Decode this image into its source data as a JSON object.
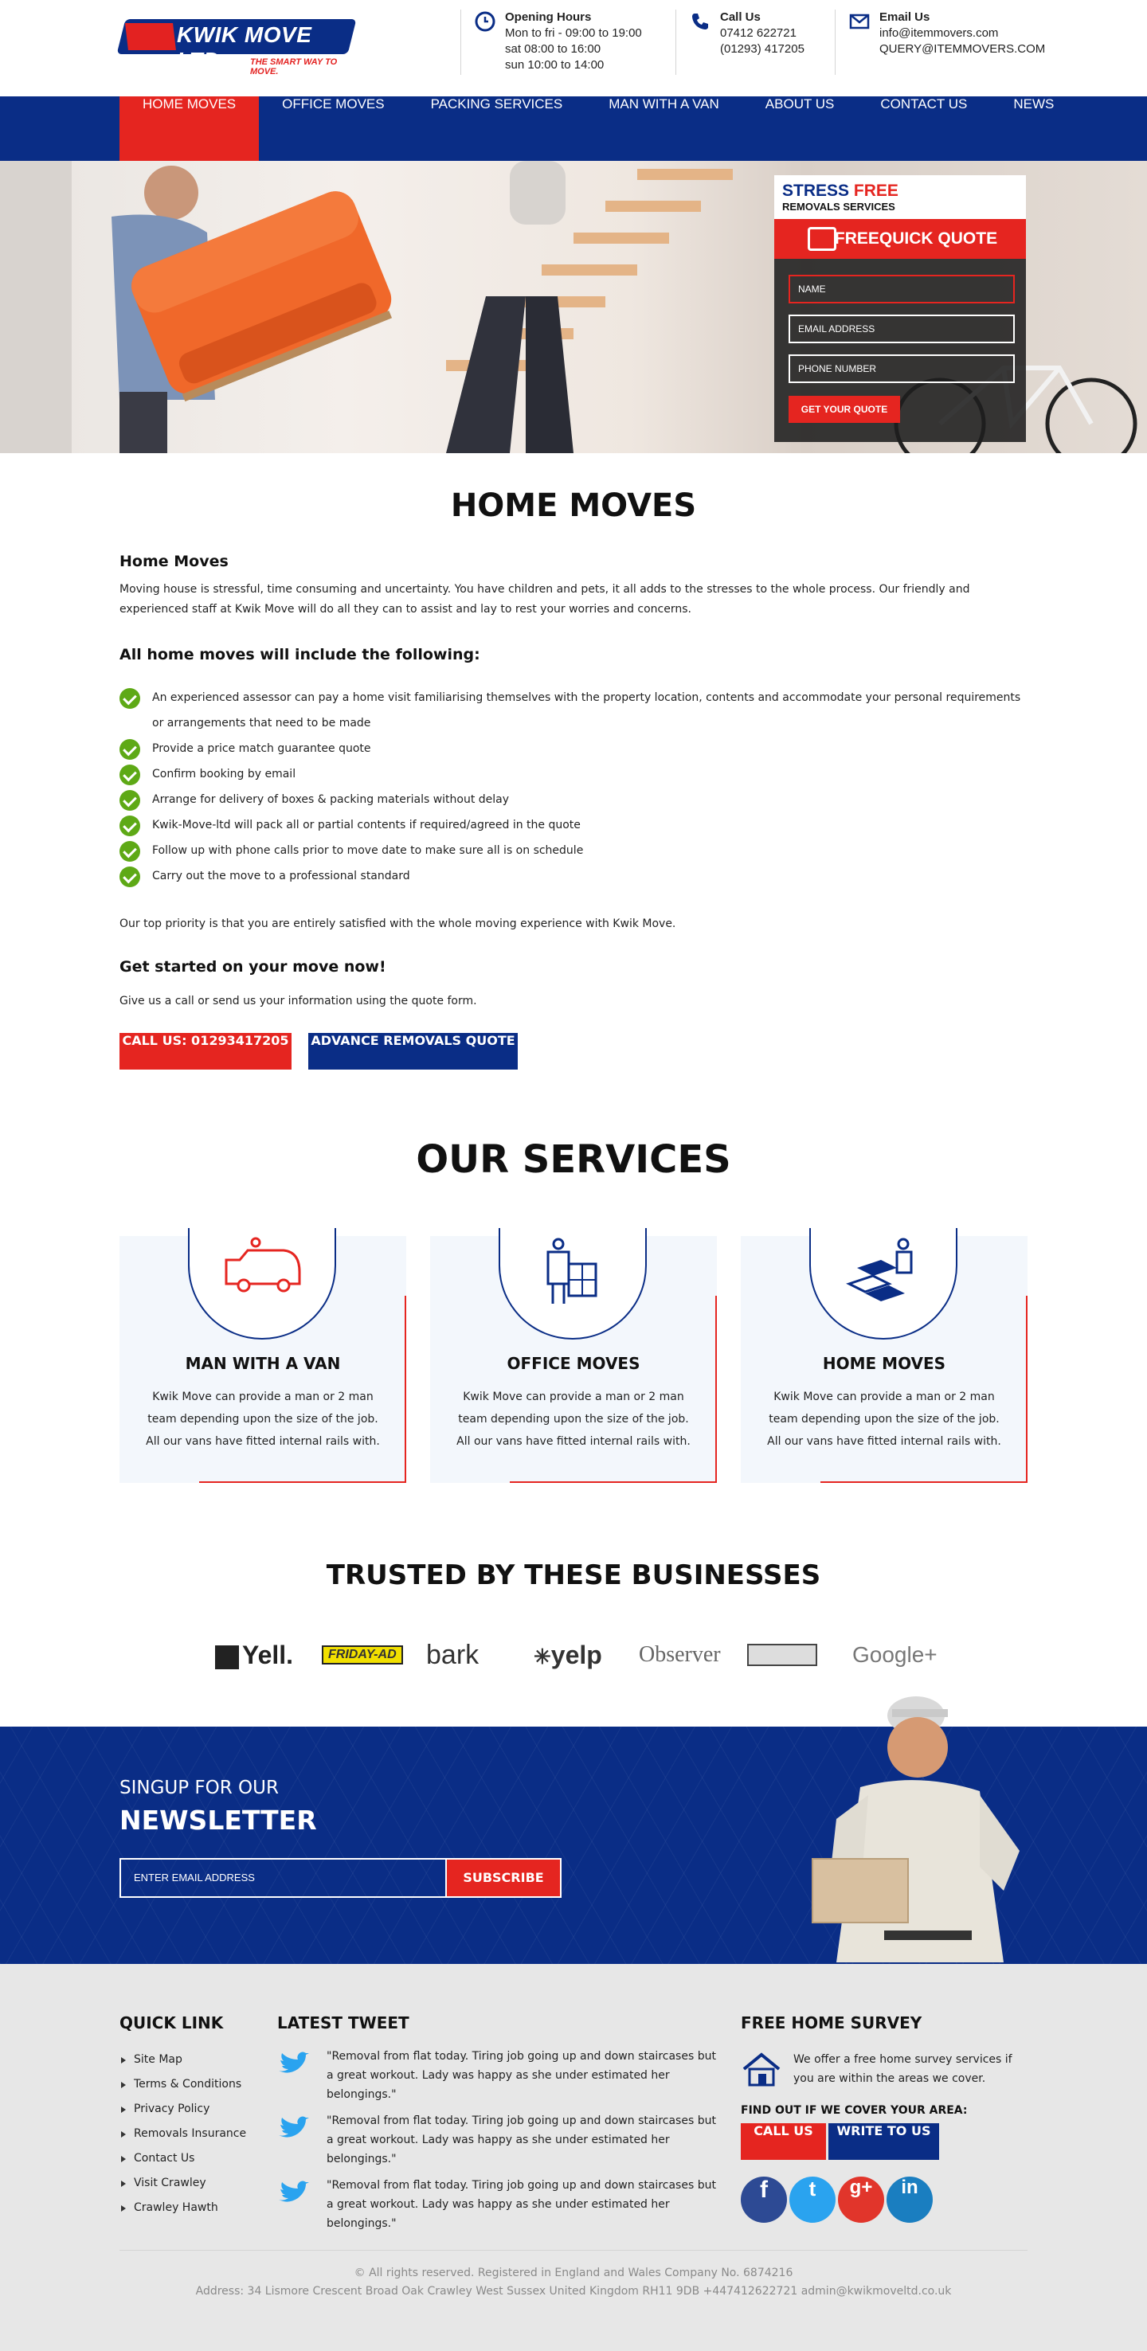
{
  "header": {
    "logo_text": "KWIK MOVE LTD",
    "logo_tagline": "THE SMART WAY TO MOVE.",
    "hours": {
      "title": "Opening Hours",
      "line1": "Mon to fri - 09:00  to 19:00",
      "line2": "sat 08:00  to 16:00",
      "line3": "sun 10:00 to 14:00"
    },
    "call": {
      "title": "Call Us",
      "line1": "07412 622721",
      "line2": "(01293) 417205"
    },
    "email": {
      "title": "Email Us",
      "line1": "info@itemmovers.com",
      "line2": "QUERY@ITEMMOVERS.COM"
    }
  },
  "nav": [
    "HOME MOVES",
    "OFFICE MOVES",
    "PACKING SERVICES",
    "MAN WITH A VAN",
    "ABOUT US",
    "CONTACT US",
    "NEWS"
  ],
  "quote": {
    "stress": "STRESS",
    "free": "FREE",
    "sub": "REMOVALS SERVICES",
    "head": "FREEQUICK QUOTE",
    "name_ph": "NAME",
    "email_ph": "EMAIL ADDRESS",
    "phone_ph": "PHONE NUMBER",
    "button": "GET YOUR QUOTE"
  },
  "home": {
    "title": "HOME MOVES",
    "subtitle": "Home Moves",
    "intro": "Moving house is stressful, time consuming and uncertainty. You have children and pets, it all adds to the stresses to the whole process. Our friendly and experienced staff at Kwik Move will do all they can to assist and lay to rest your worries and concerns.",
    "list_title": "All home moves will include the following:",
    "items": [
      "An experienced assessor can pay a home visit familiarising themselves with the property location, contents and accommodate your personal requirements or arrangements that need to be made",
      "Provide a price match guarantee quote",
      "Confirm booking by email",
      "Arrange for delivery of boxes & packing materials without delay",
      "Kwik-Move-ltd will pack all or partial contents if required/agreed in the quote",
      "Follow up with phone calls prior to move date to make sure all is on schedule",
      "Carry out the move to a professional standard"
    ],
    "priority": "Our top priority is that you are entirely satisfied with the whole moving experience with Kwik Move.",
    "started_title": "Get started on your move now!",
    "started_text": "Give us a call or send us your information using the quote form.",
    "call_button": "CALL US: 01293417205",
    "advance_button": "ADVANCE REMOVALS QUOTE"
  },
  "services": {
    "title": "OUR SERVICES",
    "items": [
      {
        "title": "MAN WITH A VAN",
        "desc": "Kwik Move can provide a man or 2 man team depending upon the size of the job. All our vans have fitted internal rails with.",
        "icon": "van-icon"
      },
      {
        "title": "OFFICE MOVES",
        "desc": "Kwik Move can provide a man or 2 man team depending upon the size of the job. All our vans have fitted internal rails with.",
        "icon": "trolley-icon"
      },
      {
        "title": "HOME MOVES",
        "desc": "Kwik Move can provide a man or 2 man team depending upon the size of the job. All our vans have fitted internal rails with.",
        "icon": "boxes-icon"
      }
    ]
  },
  "trusted": {
    "title": "TRUSTED BY THESE BUSINESSES",
    "logos": [
      "Yell.",
      "FRIDAY-AD",
      "bark",
      "yelp",
      "Observer",
      "",
      "Google+"
    ]
  },
  "newsletter": {
    "line1": "SINGUP FOR OUR",
    "line2": "NEWSLETTER",
    "placeholder": "ENTER EMAIL ADDRESS",
    "button": "SUBSCRIBE"
  },
  "footer": {
    "quick_title": "QUICK LINK",
    "links": [
      "Site Map",
      "Terms & Conditions",
      "Privacy Policy",
      "Removals Insurance",
      "Contact Us",
      "Visit Crawley",
      "Crawley Hawth"
    ],
    "tweet_title": "LATEST TWEET",
    "tweets": [
      "\"Removal from flat today. Tiring job going up and down staircases but a great workout. Lady was happy as she under estimated her belongings.\"",
      "\"Removal from flat today. Tiring job going up and down staircases but a great workout. Lady was happy as she under estimated her belongings.\"",
      "\"Removal from flat today. Tiring job going up and down staircases but a great workout. Lady was happy as she under estimated her belongings.\""
    ],
    "survey_title": "FREE HOME SURVEY",
    "survey_text": "We offer a free home survey services if you are within the areas we cover.",
    "cover_title": "FIND OUT IF WE COVER YOUR AREA:",
    "call_btn": "CALL US",
    "write_btn": "WRITE TO US",
    "social": [
      "f",
      "t",
      "g+",
      "in"
    ],
    "copyright": "© All rights reserved. Registered in England and Wales Company No. 6874216",
    "address": "Address: 34 Lismore Crescent Broad Oak Crawley West Sussex United Kingdom RH11 9DB +447412622721 admin@kwikmoveltd.co.uk"
  },
  "colors": {
    "brand_blue": "#0a2d86",
    "brand_red": "#e52520",
    "check_green": "#5ea916"
  }
}
